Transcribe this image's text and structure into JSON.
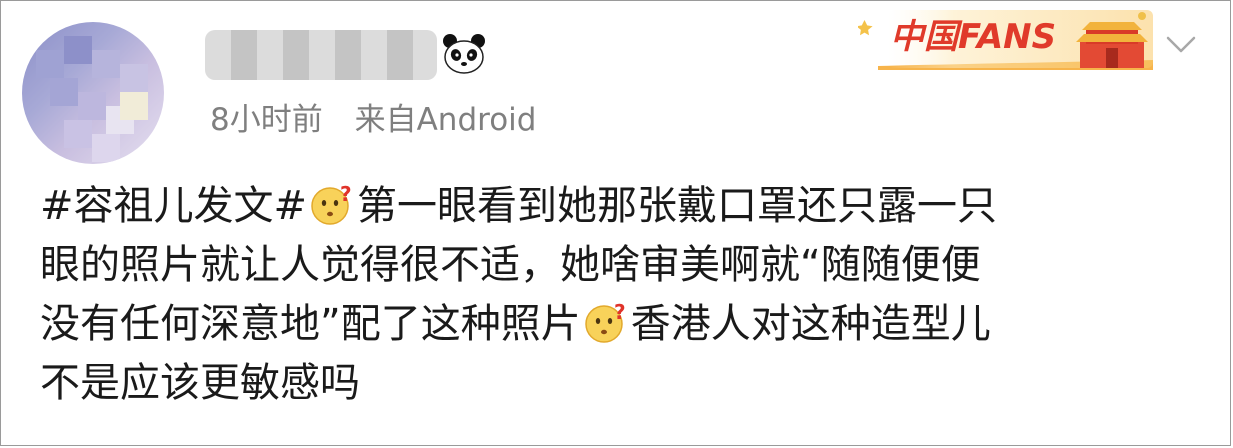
{
  "user": {
    "name_hidden": true,
    "avatar_hidden": true
  },
  "meta": {
    "time": "8小时前",
    "source_prefix": "来自",
    "source_app": "Android"
  },
  "badge": {
    "text": "中国FANS"
  },
  "post": {
    "hashtag": "#容祖儿发文#",
    "line1": "第一眼看到她那张戴口罩还只露一只",
    "line2": "眼的照片就让人觉得很不适，她啥审美啊就“随随便便",
    "line3a": "没有任何深意地”配了这种照片",
    "line3b": "香港人对这种造型儿",
    "line4": "不是应该更敏感吗"
  },
  "icons": [
    "panda-icon",
    "thinking-emoji-icon",
    "chevron-down-icon"
  ],
  "colors": {
    "meta_gray": "#7f7f7f",
    "text": "#1a1a1a",
    "badge_red": "#e23b2b",
    "badge_orange": "#f6b04a"
  }
}
